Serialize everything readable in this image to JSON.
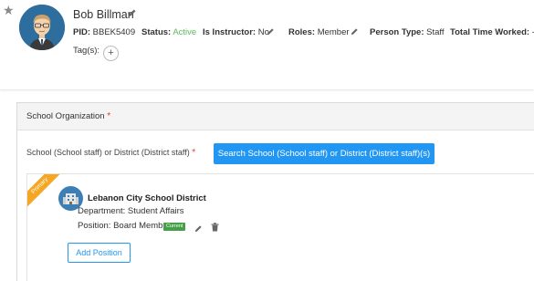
{
  "header": {
    "star_icon": "star-icon",
    "name": "Bob Billman",
    "pid_label": "PID:",
    "pid_value": "BBEK5409",
    "status_label": "Status:",
    "status_value": "Active",
    "instructor_label": "Is Instructor:",
    "instructor_value": "No",
    "roles_label": "Roles:",
    "roles_value": "Member",
    "person_type_label": "Person Type:",
    "person_type_value": "Staff",
    "total_time_label": "Total Time Worked:",
    "total_time_value": "-",
    "tags_label": "Tag(s):",
    "tag_add": "+"
  },
  "school_org": {
    "title": "School Organization",
    "required_mark": "*",
    "field_label": "School (School staff) or District (District staff)",
    "field_required": "*",
    "search_button": "Search School (School staff) or District (District staff)(s)",
    "card": {
      "ribbon": "Primary",
      "school_name": "Lebanon City School District",
      "department": "Department: Student Affairs",
      "position": "Position: Board Member",
      "current_badge": "Current",
      "add_position": "Add Position"
    }
  },
  "colors": {
    "primary": "#2196f3",
    "active_green": "#5cb85c",
    "badge_green": "#43a047",
    "ribbon_orange": "#f5a623",
    "required_red": "#e53935"
  }
}
